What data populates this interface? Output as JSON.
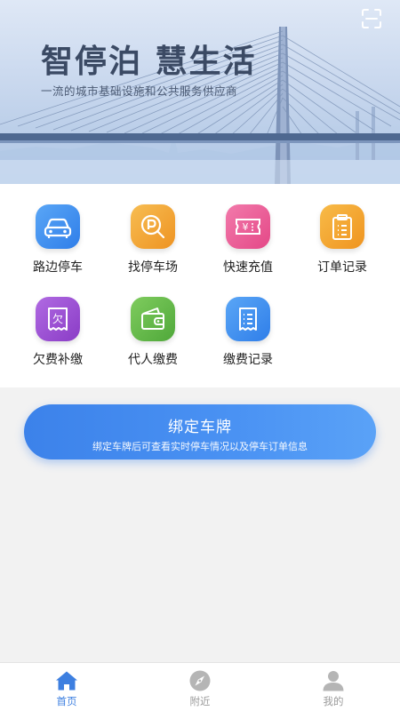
{
  "banner": {
    "title": "智停泊 慧生活",
    "subtitle": "一流的城市基础设施和公共服务供应商"
  },
  "grid": {
    "items": [
      {
        "label": "路边停车",
        "icon": "car-icon",
        "color": "#3f8ff0"
      },
      {
        "label": "找停车场",
        "icon": "parking-search-icon",
        "color": "#f1a63a"
      },
      {
        "label": "快速充值",
        "icon": "ticket-yen-icon",
        "color": "#ea5a93"
      },
      {
        "label": "订单记录",
        "icon": "clipboard-icon",
        "color": "#f3a531"
      },
      {
        "label": "欠费补缴",
        "icon": "arrears-receipt-icon",
        "color": "#9b4fd1"
      },
      {
        "label": "代人缴费",
        "icon": "wallet-icon",
        "color": "#63b94c"
      },
      {
        "label": "缴费记录",
        "icon": "receipt-list-icon",
        "color": "#3f8ff0"
      }
    ]
  },
  "bind": {
    "title": "绑定车牌",
    "subtitle": "绑定车牌后可查看实时停车情况以及停车订单信息"
  },
  "nav": {
    "items": [
      {
        "label": "首页",
        "icon": "home-icon",
        "active": true
      },
      {
        "label": "附近",
        "icon": "compass-icon",
        "active": false
      },
      {
        "label": "我的",
        "icon": "person-icon",
        "active": false
      }
    ]
  },
  "colors": {
    "accent": "#3d7fe0",
    "inactive": "#9a9a9a"
  }
}
